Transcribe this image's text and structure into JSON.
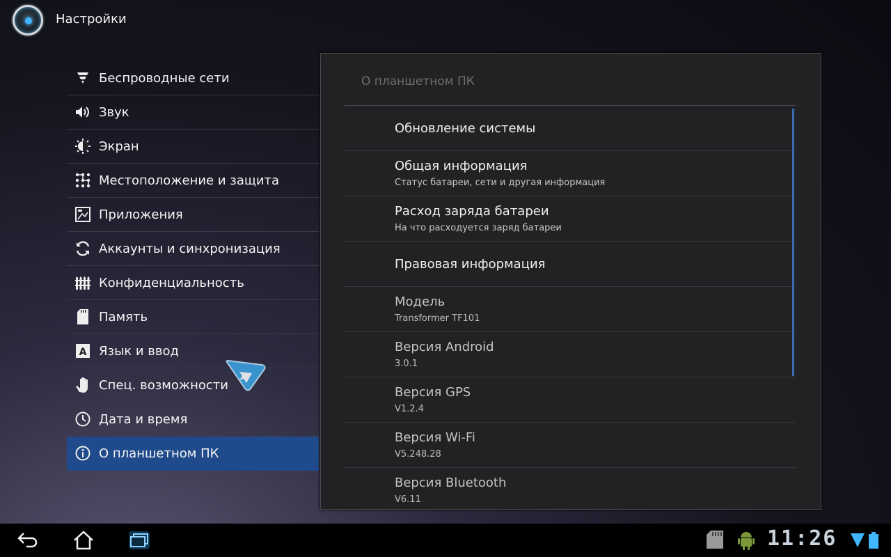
{
  "app": {
    "title": "Настройки",
    "icon": "settings-app-icon"
  },
  "menu": {
    "items": [
      {
        "label": "Беспроводные сети",
        "icon": "wireless-icon"
      },
      {
        "label": "Звук",
        "icon": "speaker-icon"
      },
      {
        "label": "Экран",
        "icon": "brightness-icon"
      },
      {
        "label": "Местоположение и защита",
        "icon": "location-grid-icon"
      },
      {
        "label": "Приложения",
        "icon": "applications-icon"
      },
      {
        "label": "Аккаунты и синхронизация",
        "icon": "sync-icon"
      },
      {
        "label": "Конфиденциальность",
        "icon": "privacy-fence-icon"
      },
      {
        "label": "Память",
        "icon": "sd-card-icon"
      },
      {
        "label": "Язык и ввод",
        "icon": "language-icon"
      },
      {
        "label": "Спец. возможности",
        "icon": "hand-icon"
      },
      {
        "label": "Дата и время",
        "icon": "clock-icon"
      },
      {
        "label": "О планшетном ПК",
        "icon": "info-icon",
        "selected": true
      }
    ]
  },
  "panel": {
    "title": "О планшетном ПК",
    "items": [
      {
        "title": "Обновление системы",
        "subtitle": ""
      },
      {
        "title": "Общая информация",
        "subtitle": "Статус батареи, сети и другая информация"
      },
      {
        "title": "Расход заряда батареи",
        "subtitle": "На что расходуется заряд батареи"
      },
      {
        "title": "Правовая информация",
        "subtitle": ""
      },
      {
        "title": "Модель",
        "subtitle": "Transformer TF101"
      },
      {
        "title": "Версия Android",
        "subtitle": "3.0.1"
      },
      {
        "title": "Версия GPS",
        "subtitle": "V1.2.4"
      },
      {
        "title": "Версия Wi-Fi",
        "subtitle": "V5.248.28"
      },
      {
        "title": "Версия Bluetooth",
        "subtitle": "V6.11"
      }
    ]
  },
  "system_bar": {
    "clock": "11:26",
    "accent_color": "#3fb6ff"
  },
  "colors": {
    "selected_item": "#1f4b8c",
    "scrollbar": "#3a6bb0"
  }
}
